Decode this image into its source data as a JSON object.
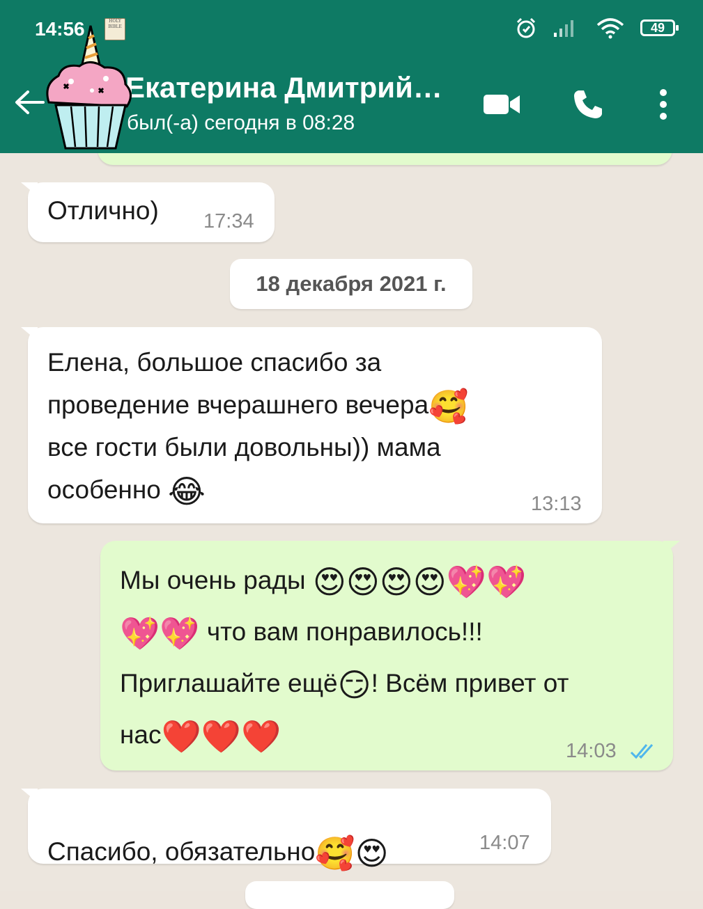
{
  "status_bar": {
    "time": "14:56",
    "battery": "49",
    "bible_label": "HOLY BIBLE"
  },
  "header": {
    "contact_name": "Екатерина Дмитрий…",
    "contact_status": "был(-а) сегодня в 08:28"
  },
  "messages": [
    {
      "direction": "in",
      "text": "Отлично)",
      "time": "17:34"
    },
    {
      "direction": "date",
      "text": "18 декабря 2021 г."
    },
    {
      "direction": "in",
      "line1": "Елена, большое спасибо за",
      "line2": "проведение вчерашнего вечера",
      "line2_emoji": "🥰",
      "line3": "все гости были довольны)) мама",
      "line4": "особенно ",
      "line4_emoji": "😂",
      "time": "13:13"
    },
    {
      "direction": "out",
      "line1": "Мы очень рады ",
      "line1_emoji": "😍😍😍😍💖💖",
      "line2_emoji": "💖💖",
      "line2": " что вам понравилось!!!",
      "line3a": "Приглашайте ещё",
      "line3_emoji": "😏",
      "line3b": "! Всём привет от",
      "line4": "нас",
      "line4_emoji": "❤️❤️❤️",
      "time": "14:03",
      "status": "read"
    },
    {
      "direction": "in",
      "text": "Спасибо, обязательно",
      "emoji": "🥰😍",
      "time": "14:07"
    }
  ],
  "colors": {
    "header": "#0e7a64",
    "outgoing_bubble": "#e2fbcd",
    "incoming_bubble": "#ffffff",
    "read_ticks": "#4fb6ec"
  },
  "icons": [
    "back-arrow-icon",
    "video-call-icon",
    "phone-icon",
    "more-vert-icon",
    "alarm-icon",
    "signal-icon",
    "wifi-icon",
    "battery-icon",
    "cupcake-avatar"
  ]
}
